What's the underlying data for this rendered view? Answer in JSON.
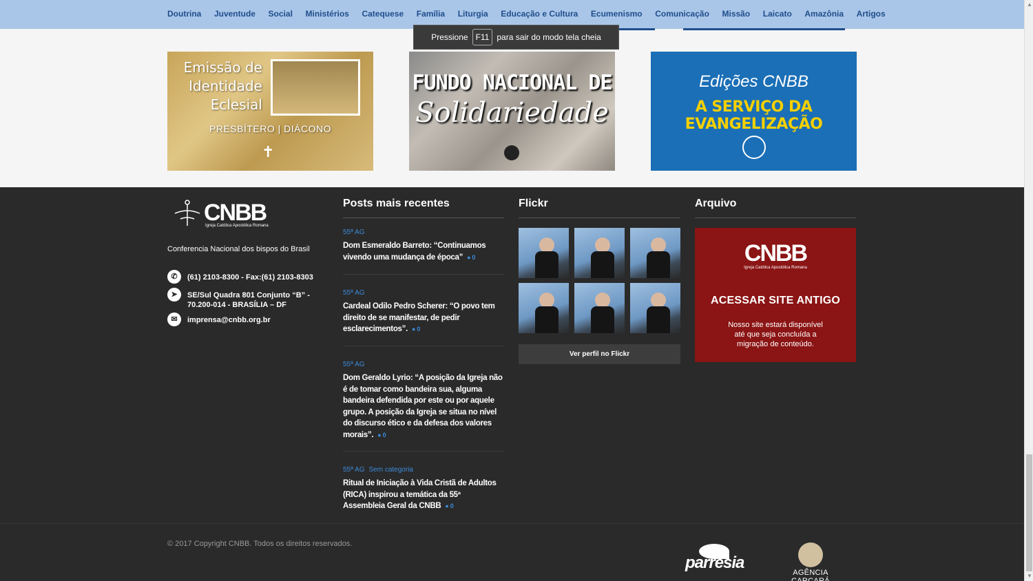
{
  "nav": {
    "items": [
      "Doutrina",
      "Juventude",
      "Social",
      "Ministérios",
      "Catequese",
      "Família",
      "Liturgia",
      "Educação e Cultura",
      "Ecumenismo",
      "Comunicação",
      "Missão",
      "Laicato",
      "Amazônia",
      "Artigos"
    ]
  },
  "toast": {
    "prefix": "Pressione",
    "key": "F11",
    "suffix": "para sair do modo tela cheia"
  },
  "banners": {
    "b1": {
      "title": "Emissão de Identidade Eclesial",
      "subtitle": "PRESBÍTERO | DIÁCONO"
    },
    "b2": {
      "line1": "FUNDO NACIONAL DE",
      "line2": "Solidariedade"
    },
    "b3": {
      "line1": "Edições CNBB",
      "line2": "A SERVIÇO DA EVANGELIZAÇÃO"
    }
  },
  "footer": {
    "logo": {
      "name": "CNBB",
      "sub": "Igreja Católica Apostólica Romana"
    },
    "tagline": "Conferencia Nacional dos bispos do Brasil",
    "contact": {
      "phone": "(61) 2103-8300 - Fax:(61) 2103-8303",
      "address": "SE/Sul Quadra 801 Conjunto “B” - 70.200-014 - BRASÍLIA – DF",
      "email": "imprensa@cnbb.org.br"
    },
    "posts_title": "Posts mais recentes",
    "posts": [
      {
        "cats": [
          "55ª AG"
        ],
        "title": "Dom Esmeraldo Barreto: “Continuamos vivendo uma mudança de época”",
        "comments": "0"
      },
      {
        "cats": [
          "55ª AG"
        ],
        "title": "Cardeal Odilo Pedro Scherer: “O povo tem direito de se manifestar, de pedir esclarecimentos”.",
        "comments": "0"
      },
      {
        "cats": [
          "55ª AG"
        ],
        "title": "Dom Geraldo Lyrio: “A posição da Igreja não é de tomar como bandeira sua, alguma bandeira defendida por este ou por aquele grupo. A posição da Igreja se situa no nível do discurso ético e da defesa dos valores morais”.",
        "comments": "0"
      },
      {
        "cats": [
          "55ª AG",
          "Sem categoria"
        ],
        "title": "Ritual de Iniciação à Vida Cristã de Adultos (RICA) inspirou a temática da 55ª Assembleia Geral da CNBB",
        "comments": "0"
      }
    ],
    "flickr_title": "Flickr",
    "flickr_button": "Ver perfil no Flickr",
    "archive_title": "Arquivo",
    "archive": {
      "logo": "CNBB",
      "logo_sub": "Igreja Católica Apostólica Romana",
      "heading": "ACESSAR SITE ANTIGO",
      "text": "Nosso site estará disponível até que seja concluída a migração de conteúdo."
    }
  },
  "bottom": {
    "copyright": "© 2017 Copyright CNBB. Todos os direitos reservados.",
    "partner1": "parresia",
    "partner2": "AGÊNCIA CARCARÁ"
  },
  "colors": {
    "nav_bg": "#a9c6e8",
    "nav_text": "#1f4d8c",
    "footer_bg": "#2a2a2a",
    "link_blue": "#3b8bd8",
    "archive_red": "#8b1414"
  }
}
